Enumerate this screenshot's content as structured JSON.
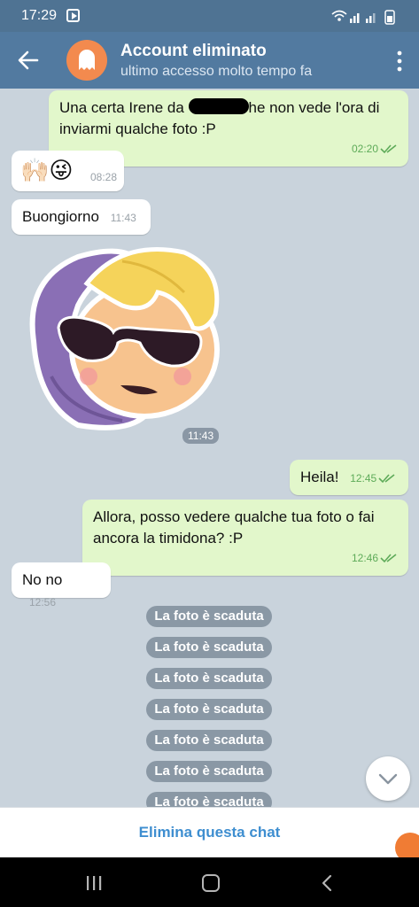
{
  "status_bar": {
    "time": "17:29"
  },
  "header": {
    "title": "Account eliminato",
    "subtitle": "ultimo accesso molto tempo fa"
  },
  "messages": [
    {
      "direction": "out",
      "text_before": "Una certa Irene da",
      "text_after": "he non vede l'ora di inviarmi qualche foto :P",
      "time": "02:20"
    },
    {
      "direction": "in",
      "text": "🙌🏻😜",
      "time": "08:28"
    },
    {
      "direction": "in",
      "text": "Buongiorno",
      "time": "11:43"
    },
    {
      "direction": "in",
      "type": "sticker",
      "time": "11:43"
    },
    {
      "direction": "out",
      "text": "Heila!",
      "time": "12:45"
    },
    {
      "direction": "out",
      "text": "Allora, posso vedere qualche tua foto o fai ancora la timidona? :P",
      "time": "12:46"
    },
    {
      "direction": "in",
      "text": "No no",
      "time": "12:56"
    }
  ],
  "expired_label": "La foto è scaduta",
  "action": {
    "label": "Elimina questa chat"
  },
  "icons": {
    "back": "arrow-left-icon",
    "avatar": "ghost-icon",
    "more": "more-vertical-icon",
    "scroll": "chevron-down-icon"
  },
  "colors": {
    "header": "#527aa0",
    "status_bar": "#4f7393",
    "outgoing_bubble": "#e2f7cb",
    "incoming_bubble": "#ffffff",
    "accent": "#3e8ed0",
    "avatar": "#f38a4e"
  }
}
